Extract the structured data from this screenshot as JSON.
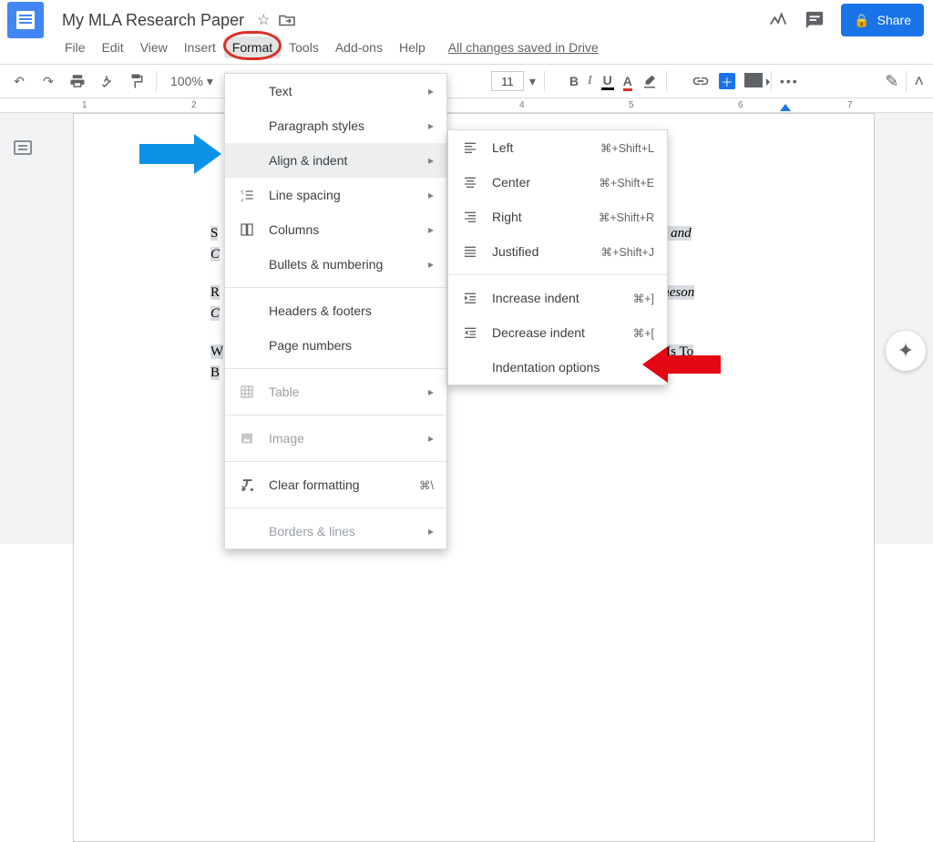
{
  "header": {
    "title": "My MLA Research Paper",
    "saved_status": "All changes saved in Drive",
    "share_label": "Share"
  },
  "menubar": {
    "file": "File",
    "edit": "Edit",
    "view": "View",
    "insert": "Insert",
    "format": "Format",
    "tools": "Tools",
    "addons": "Add-ons",
    "help": "Help"
  },
  "toolbar": {
    "zoom": "100%",
    "font_size": "11",
    "bold": "B",
    "italic": "I",
    "underline": "U",
    "text_color": "A"
  },
  "ruler": {
    "ticks": [
      "1",
      "2",
      "3",
      "4",
      "5",
      "6",
      "7"
    ]
  },
  "format_menu": {
    "text": "Text",
    "paragraph_styles": "Paragraph styles",
    "align_indent": "Align & indent",
    "line_spacing": "Line spacing",
    "columns": "Columns",
    "bullets_numbering": "Bullets & numbering",
    "headers_footers": "Headers & footers",
    "page_numbers": "Page numbers",
    "table": "Table",
    "image": "Image",
    "clear_formatting": "Clear formatting",
    "clear_formatting_shortcut": "⌘\\",
    "borders_lines": "Borders & lines"
  },
  "align_submenu": {
    "left": {
      "label": "Left",
      "shortcut": "⌘+Shift+L"
    },
    "center": {
      "label": "Center",
      "shortcut": "⌘+Shift+E"
    },
    "right": {
      "label": "Right",
      "shortcut": "⌘+Shift+R"
    },
    "just": {
      "label": "Justified",
      "shortcut": "⌘+Shift+J"
    },
    "inc": {
      "label": "Increase indent",
      "shortcut": "⌘+]"
    },
    "dec": {
      "label": "Decrease indent",
      "shortcut": "⌘+["
    },
    "opts": {
      "label": "Indentation options"
    }
  },
  "document": {
    "p1a": "S",
    "p1b": "herhoods and",
    "p1c": "C",
    "p2a": "R",
    "p2b": "R.D. Jameson",
    "p2c": "C",
    "p3a": "W",
    "p3b": "ho Is To",
    "p3c": "B"
  }
}
